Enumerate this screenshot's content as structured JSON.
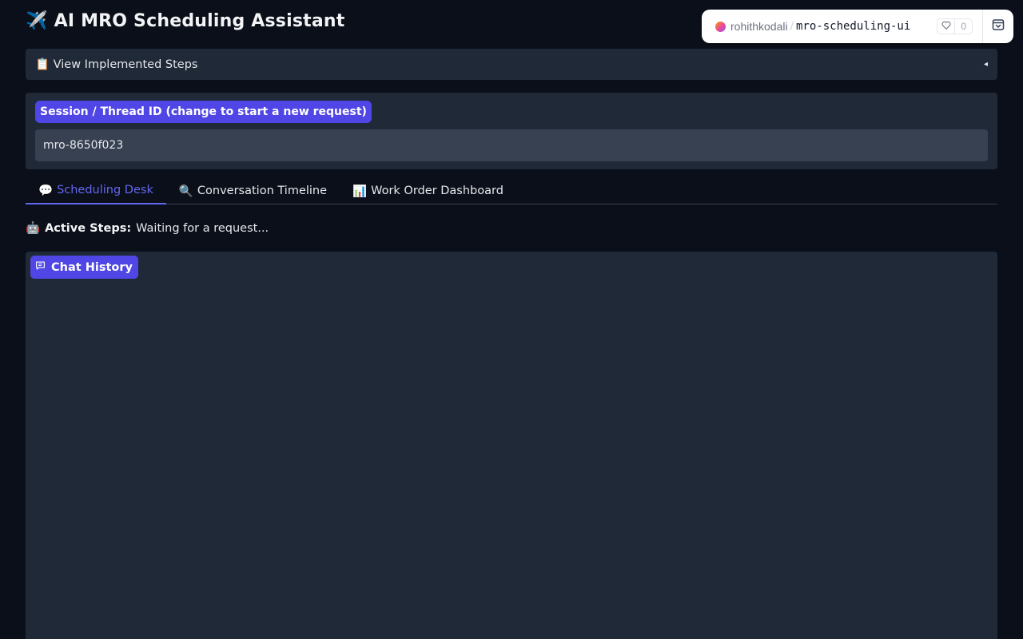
{
  "header": {
    "title_emoji": "✈️",
    "title": "AI MRO Scheduling Assistant"
  },
  "hf_badge": {
    "user": "rohithkodali",
    "separator": "/",
    "repo": "mro-scheduling-ui",
    "likes": "0"
  },
  "accordion": {
    "label": "📋 View Implemented Steps",
    "caret": "◂"
  },
  "session": {
    "label": "Session / Thread ID (change to start a new request)",
    "value": "mro-8650f023"
  },
  "tabs": [
    {
      "icon": "💬",
      "label": "Scheduling Desk",
      "active": true
    },
    {
      "icon": "🔍",
      "label": "Conversation Timeline",
      "active": false
    },
    {
      "icon": "📊",
      "label": "Work Order Dashboard",
      "active": false
    }
  ],
  "status": {
    "icon": "🤖",
    "label": "Active Steps:",
    "text": "Waiting for a request..."
  },
  "chat": {
    "label": "Chat History"
  },
  "colors": {
    "background": "#0b0f19",
    "panel": "#1f2937",
    "accent": "#4f46e5",
    "active_tab": "#6366f1"
  }
}
